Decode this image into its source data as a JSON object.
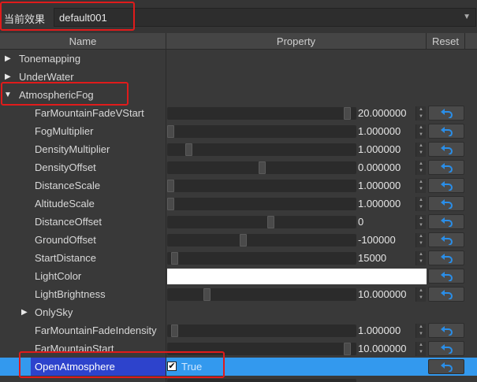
{
  "toolbar": {
    "effect_label": "当前效果",
    "effect_value": "default001"
  },
  "columns": {
    "name": "Name",
    "property": "Property",
    "reset": "Reset"
  },
  "tree": {
    "groups": [
      {
        "label": "Tonemapping",
        "expanded": false
      },
      {
        "label": "UnderWater",
        "expanded": false
      },
      {
        "label": "AtmosphericFog",
        "expanded": true
      }
    ],
    "properties": [
      {
        "label": "FarMountainFadeVStart",
        "value": "20.000000",
        "slider_fraction": 0.97
      },
      {
        "label": "FogMultiplier",
        "value": "1.000000",
        "slider_fraction": 0.0
      },
      {
        "label": "DensityMultiplier",
        "value": "1.000000",
        "slider_fraction": 0.1
      },
      {
        "label": "DensityOffset",
        "value": "0.000000",
        "slider_fraction": 0.5
      },
      {
        "label": "DistanceScale",
        "value": "1.000000",
        "slider_fraction": 0.0
      },
      {
        "label": "AltitudeScale",
        "value": "1.000000",
        "slider_fraction": 0.0
      },
      {
        "label": "DistanceOffset",
        "value": "0",
        "slider_fraction": 0.55
      },
      {
        "label": "GroundOffset",
        "value": "-100000",
        "slider_fraction": 0.4
      },
      {
        "label": "StartDistance",
        "value": "15000",
        "slider_fraction": 0.02
      }
    ],
    "light_color": {
      "label": "LightColor",
      "color": "#ffffff"
    },
    "light_brightness": {
      "label": "LightBrightness",
      "value": "10.000000",
      "slider_fraction": 0.2
    },
    "only_sky": {
      "label": "OnlySky",
      "expanded": false
    },
    "props2": [
      {
        "label": "FarMountainFadeIndensity",
        "value": "1.000000",
        "slider_fraction": 0.02
      },
      {
        "label": "FarMountainStart",
        "value": "10.000000",
        "slider_fraction": 0.97
      }
    ],
    "open_atmosphere": {
      "label": "OpenAtmosphere",
      "checked": true,
      "value_text": "True"
    }
  },
  "colors": {
    "accent": "#3399ee",
    "highlight": "#e01b1b",
    "reset_icon": "#2a8ee8"
  },
  "icons": {
    "reset": "undo-arrow-icon",
    "expand": "triangle-right-icon",
    "collapse": "triangle-down-icon"
  }
}
